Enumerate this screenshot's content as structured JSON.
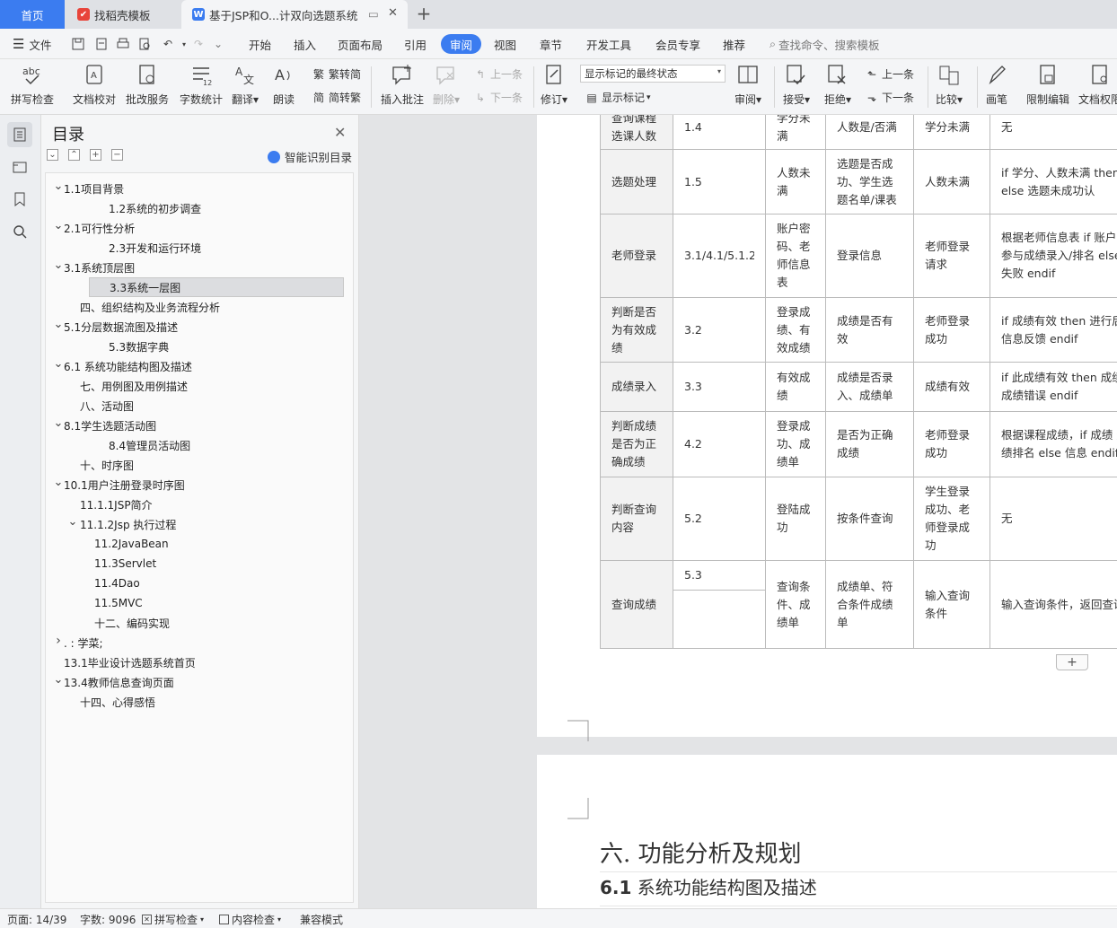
{
  "tabs": {
    "home": "首页",
    "find_template": "找稻壳模板",
    "document": "基于JSP和O...计双向选题系统"
  },
  "menubar": {
    "file": "文件",
    "items": [
      "开始",
      "插入",
      "页面布局",
      "引用",
      "审阅",
      "视图",
      "章节",
      "开发工具",
      "会员专享",
      "推荐"
    ],
    "search_placeholder": "查找命令、搜索模板"
  },
  "ribbon": {
    "spell_check": "拼写检查",
    "doc_proofread": "文档校对",
    "review_service": "批改服务",
    "word_count": "字数统计",
    "translate": "翻译",
    "read_aloud": "朗读",
    "to_traditional": "繁转简",
    "to_simplified": "简转繁",
    "insert_comment": "插入批注",
    "delete": "删除",
    "prev": "上一条",
    "next": "下一条",
    "track_changes": "修订",
    "mark_state": "显示标记的最终状态",
    "show_marks": "显示标记",
    "review": "审阅",
    "accept": "接受",
    "reject": "拒绝",
    "prev2": "上一条",
    "next2": "下一条",
    "compare": "比较",
    "pen": "画笔",
    "restrict_edit": "限制编辑",
    "doc_permission": "文档权限"
  },
  "nav": {
    "title": "目录",
    "smart_toc": "智能识别目录",
    "items": [
      {
        "label": "1.1项目背景",
        "caret": "v"
      },
      {
        "label": "1.2系统的初步调查",
        "caret": ""
      },
      {
        "label": "2.1可行性分析",
        "caret": "v"
      },
      {
        "label": "2.3开发和运行环境",
        "caret": ""
      },
      {
        "label": "3.1系统顶层图",
        "caret": "v"
      },
      {
        "label": "3.3系统一层图",
        "caret": ""
      },
      {
        "label": "四、组织结构及业务流程分析",
        "caret": ""
      },
      {
        "label": "5.1分层数据流图及描述",
        "caret": "v"
      },
      {
        "label": "5.3数据字典",
        "caret": ""
      },
      {
        "label": "6.1 系统功能结构图及描述",
        "caret": "v"
      },
      {
        "label": "七、用例图及用例描述",
        "caret": ""
      },
      {
        "label": "八、活动图",
        "caret": ""
      },
      {
        "label": "8.1学生选题活动图",
        "caret": "v"
      },
      {
        "label": "8.4管理员活动图",
        "caret": ""
      },
      {
        "label": "十、时序图",
        "caret": ""
      },
      {
        "label": "10.1用户注册登录时序图",
        "caret": "v"
      },
      {
        "label": "11.1.1JSP简介",
        "caret": ""
      },
      {
        "label": "11.1.2Jsp 执行过程",
        "caret": "v"
      },
      {
        "label": "11.2JavaBean",
        "caret": ""
      },
      {
        "label": "11.3Servlet",
        "caret": ""
      },
      {
        "label": "11.4Dao",
        "caret": ""
      },
      {
        "label": "11.5MVC",
        "caret": ""
      },
      {
        "label": "十二、编码实现",
        "caret": ""
      },
      {
        "label": ". : 学菜;",
        "caret": ">"
      },
      {
        "label": "13.1毕业设计选题系统首页",
        "caret": ""
      },
      {
        "label": "13.4教师信息查询页面",
        "caret": "v"
      },
      {
        "label": "十四、心得感悟",
        "caret": ""
      }
    ]
  },
  "table": {
    "rows": [
      [
        "查询课程选课人数",
        "1.4",
        "学分未满",
        "人数是/否满",
        "学分未满",
        "无"
      ],
      [
        "选题处理",
        "1.5",
        "人数未满",
        "选题是否成功、学生选题名单/课表",
        "人数未满",
        "if 学分、人数未满 then 成功 else 选题未成功认"
      ],
      [
        "老师登录",
        "3.1/4.1/5.1.2",
        "账户密码、老师信息表",
        "登录信息",
        "老师登录请求",
        "根据老师信息表 if 账户 then 参与成绩录入/排名 else 登录失败 endif"
      ],
      [
        "判断是否为有效成绩",
        "3.2",
        "登录成绩、有效成绩",
        "成绩是否有效",
        "老师登录成功",
        "if 成绩有效 then 进行后 else 信息反馈 endif"
      ],
      [
        "成绩录入",
        "3.3",
        "有效成绩",
        "成绩是否录入、成绩单",
        "成绩有效",
        "if 此成绩有效 then 成绩 else 成绩错误 endif"
      ],
      [
        "判断成绩是否为正确成绩",
        "4.2",
        "登录成功、成绩单",
        "是否为正确成绩",
        "老师登录成功",
        "根据课程成绩，if 成绩 进行成绩排名 else 信息 endif"
      ],
      [
        "判断查询内容",
        "5.2",
        "登陆成功",
        "按条件查询",
        "学生登录成功、老师登录成功",
        "无"
      ],
      [
        "查询成绩",
        "5.3",
        "查询条件、成绩单",
        "成绩单、符合条件成绩单",
        "输入查询条件",
        "输入查询条件，返回查询"
      ]
    ]
  },
  "headings": {
    "chapter": "六. 功能分析及规划",
    "section_num": "6.1",
    "section_title": "系统功能结构图及描述"
  },
  "status": {
    "page": "页面: 14/39",
    "words": "字数: 9096",
    "spell": "拼写检查",
    "content_check": "内容检查",
    "compat": "兼容模式"
  },
  "colors": {
    "accent": "#3b7cf0",
    "wps_red": "#e8443a"
  }
}
